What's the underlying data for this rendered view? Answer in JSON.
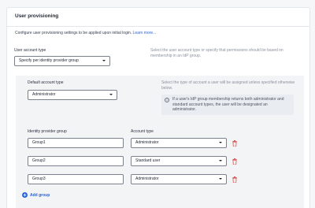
{
  "panel": {
    "title": "User provisioning",
    "intro_text": "Configure user provisioning settings to be applied upon initial login.",
    "learn_more": "Learn more..."
  },
  "account_type": {
    "label": "User account type",
    "value": "Specify per identity provider group",
    "help": "Select the user account type or specify that permissions should be based on membership in an IdP group."
  },
  "default_account": {
    "label": "Default account type",
    "value": "Administrator",
    "help": "Select the type of account a user will be assigned unless specified otherwise below."
  },
  "info": {
    "icon": "info-icon",
    "text": "If a user's IdP group membership returns both administrator and standard account types, the user will be designated an administrator."
  },
  "groups": {
    "col_group": "Identity provider group",
    "col_account": "Account type",
    "rows": [
      {
        "group": "Group1",
        "account": "Administrator"
      },
      {
        "group": "Group2",
        "account": "Standard user"
      },
      {
        "group": "Group3",
        "account": "Administrator"
      }
    ],
    "add_label": "Add group"
  },
  "colors": {
    "accent": "#2a62d6",
    "delete": "#d9534f"
  }
}
